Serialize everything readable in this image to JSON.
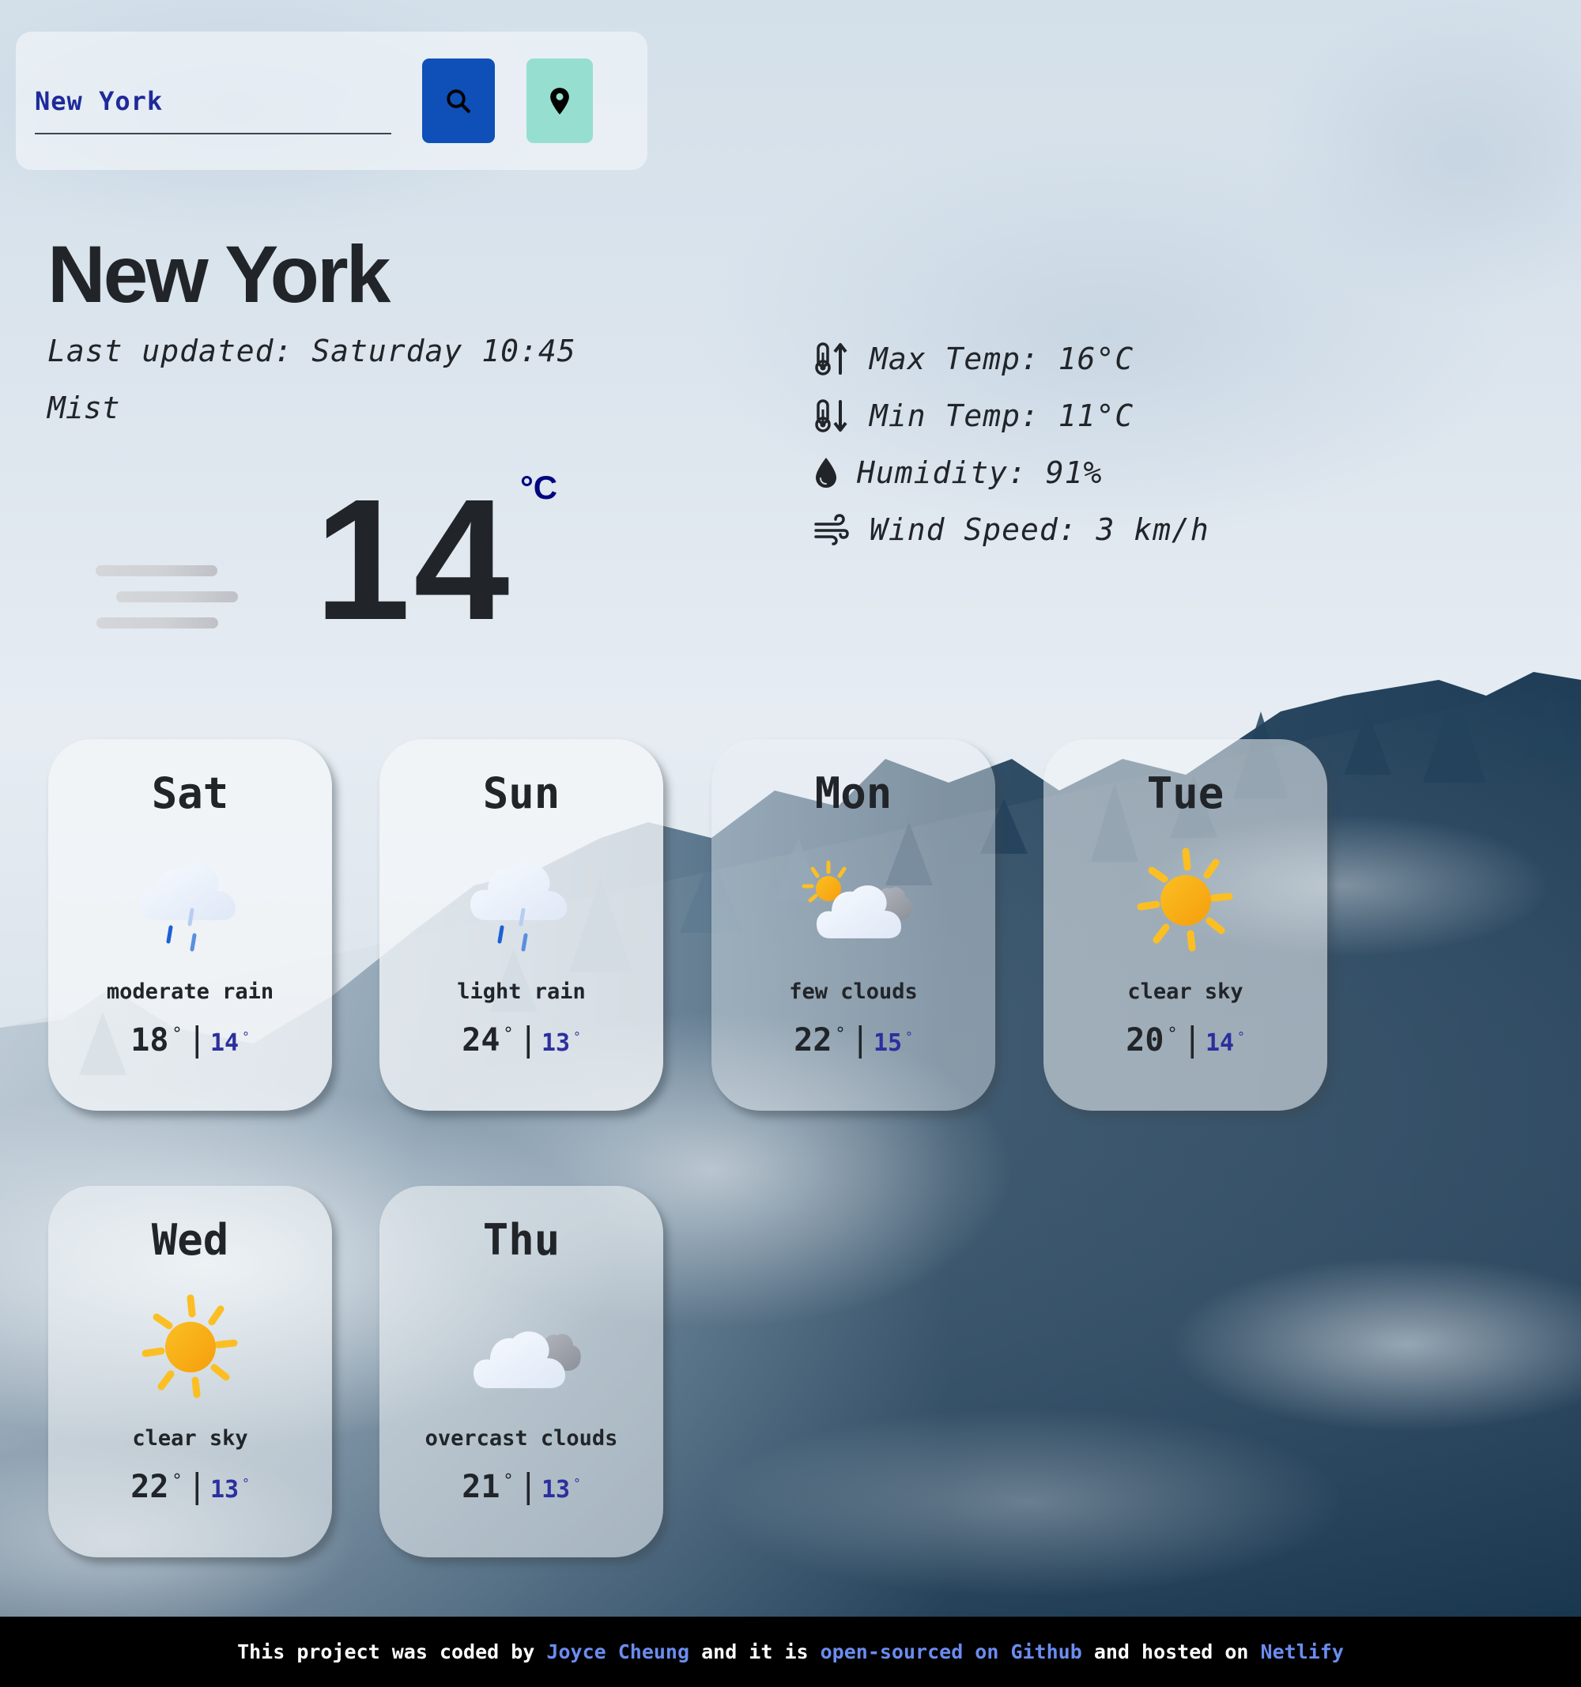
{
  "search": {
    "input_value": "New York",
    "search_button_icon": "search-icon",
    "location_button_icon": "map-pin-icon",
    "colors": {
      "search_button": "#0f50b8",
      "location_button": "#96dfd0",
      "input_text": "#1e2a9a"
    }
  },
  "current": {
    "city": "New York",
    "last_updated": "Last updated: Saturday 10:45",
    "description": "Mist",
    "icon": "mist-icon",
    "temperature": "14",
    "unit": "°C",
    "stats": [
      {
        "icon": "thermometer-up-icon",
        "label": "Max Temp: 16°C"
      },
      {
        "icon": "thermometer-down-icon",
        "label": "Min Temp: 11°C"
      },
      {
        "icon": "water-drop-icon",
        "label": "Humidity: 91%"
      },
      {
        "icon": "wind-icon",
        "label": "Wind Speed: 3 km/h"
      }
    ]
  },
  "forecast": [
    {
      "day": "Sat",
      "icon": "rain-cloud-icon",
      "description": "moderate rain",
      "max": "18",
      "min": "14",
      "deg": "°"
    },
    {
      "day": "Sun",
      "icon": "rain-cloud-icon",
      "description": "light rain",
      "max": "24",
      "min": "13",
      "deg": "°"
    },
    {
      "day": "Mon",
      "icon": "sun-behind-clouds-icon",
      "description": "few clouds",
      "max": "22",
      "min": "15",
      "deg": "°"
    },
    {
      "day": "Tue",
      "icon": "sun-icon",
      "description": "clear sky",
      "max": "20",
      "min": "14",
      "deg": "°"
    },
    {
      "day": "Wed",
      "icon": "sun-icon",
      "description": "clear sky",
      "max": "22",
      "min": "13",
      "deg": "°"
    },
    {
      "day": "Thu",
      "icon": "overcast-clouds-icon",
      "description": "overcast clouds",
      "max": "21",
      "min": "13",
      "deg": "°"
    }
  ],
  "footer": {
    "text_1": "This project was coded by ",
    "link_author": "Joyce Cheung",
    "text_2": " and it is ",
    "link_source": "open-sourced on Github",
    "text_3": " and hosted on ",
    "link_host": "Netlify",
    "link_color": "#6b8cf0"
  }
}
